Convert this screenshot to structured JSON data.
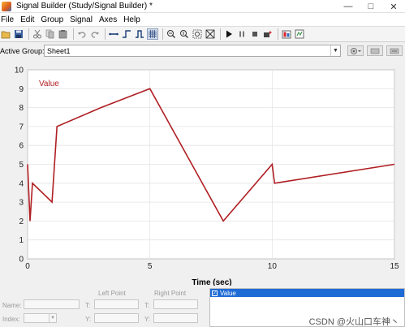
{
  "window": {
    "title": "Signal Builder (Study/Signal Builder) *",
    "minimize": "—",
    "maximize": "□",
    "close": "✕"
  },
  "menu": [
    "File",
    "Edit",
    "Group",
    "Signal",
    "Axes",
    "Help"
  ],
  "toolbar": {
    "icons": [
      "open-icon",
      "save-icon",
      "cut-icon",
      "copy-icon",
      "paste-icon",
      "undo-icon",
      "redo-icon",
      "constant-icon",
      "step-icon",
      "pulse-icon",
      "grid-icon",
      "zoom-x-icon",
      "zoom-y-icon",
      "zoom-xy-icon",
      "fit-icon",
      "start-icon",
      "pause-icon",
      "stop-icon",
      "simulink-icon",
      "scope-icon",
      "help-icon"
    ]
  },
  "group": {
    "label": "Active Group:",
    "selected": "Sheet1"
  },
  "chart_data": {
    "type": "line",
    "legend": "Value",
    "xlabel": "Time (sec)",
    "xlim": [
      0,
      15
    ],
    "ylim": [
      0,
      10
    ],
    "xticks": [
      0,
      5,
      10,
      15
    ],
    "yticks": [
      0,
      1,
      2,
      3,
      4,
      5,
      6,
      7,
      8,
      9,
      10
    ],
    "grid": true,
    "color": "#b01e23",
    "series": [
      {
        "name": "Value",
        "x": [
          0,
          0.1,
          0.2,
          1.0,
          1.2,
          3.0,
          5.0,
          8.0,
          10.0,
          10.1,
          15.0
        ],
        "y": [
          5,
          2,
          4,
          3,
          7,
          8,
          9,
          2,
          5,
          4,
          5
        ]
      }
    ]
  },
  "bottom": {
    "left_point_label": "Left Point",
    "right_point_label": "Right Point",
    "name_label": "Name:",
    "index_label": "Index:",
    "t_label": "T:",
    "y_label": "Y:",
    "signal_item": "Value"
  },
  "watermark": "CSDN @火山口车神丶"
}
